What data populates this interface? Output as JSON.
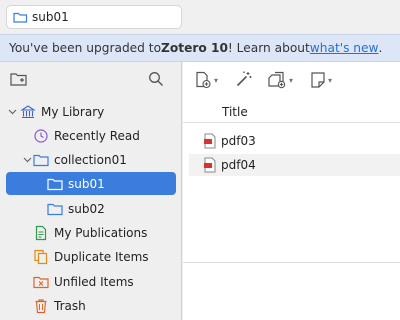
{
  "tab": {
    "label": "sub01",
    "icon": "folder-icon"
  },
  "banner": {
    "prefix": "You've been upgraded to ",
    "product": "Zotero 10",
    "middle": "! Learn about ",
    "link": "what's new",
    "suffix": "."
  },
  "left_toolbar": {
    "new_collection_icon": "new-collection-icon",
    "search_icon": "search-icon"
  },
  "tree": {
    "library": "My Library",
    "recently_read": "Recently Read",
    "collection01": "collection01",
    "sub01": "sub01",
    "sub02": "sub02",
    "my_publications": "My Publications",
    "duplicate_items": "Duplicate Items",
    "unfiled_items": "Unfiled Items",
    "trash": "Trash"
  },
  "items": {
    "column_title": "Title",
    "rows": [
      {
        "title": "pdf03"
      },
      {
        "title": "pdf04"
      }
    ]
  },
  "colors": {
    "accent": "#3b7ddd",
    "banner_bg": "#dde6f7",
    "link": "#2a6fd1"
  }
}
